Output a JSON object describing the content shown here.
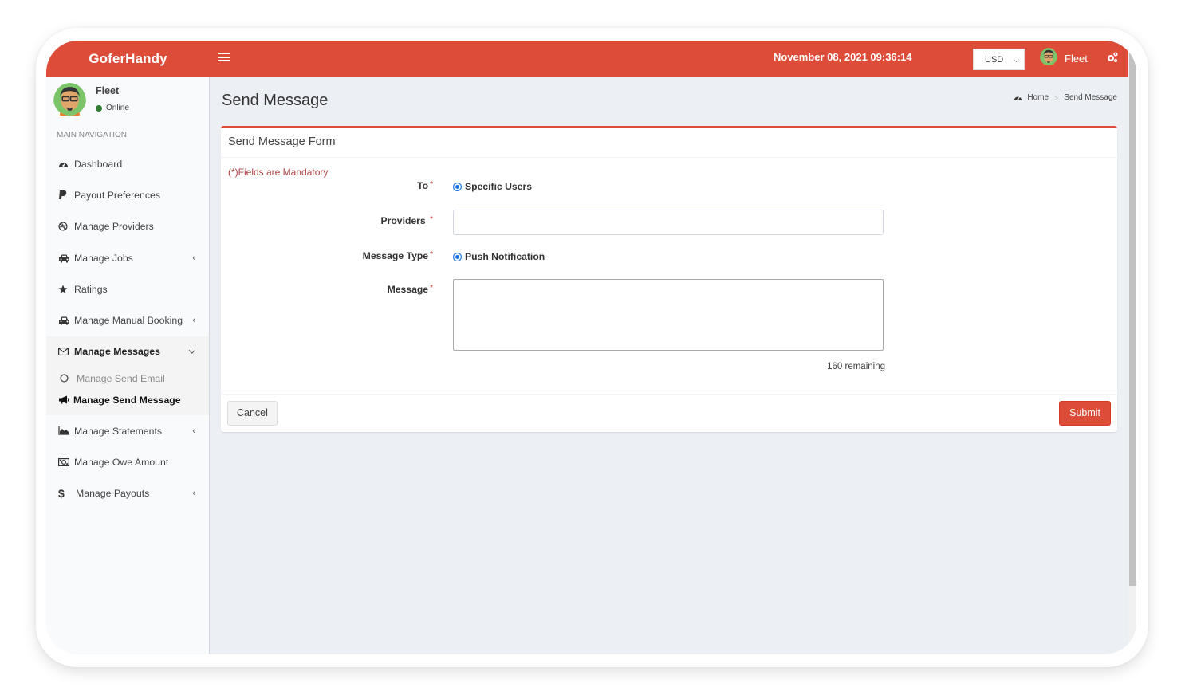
{
  "app": {
    "brand": "GoferHandy",
    "brand_color": "#dd4b39"
  },
  "header": {
    "menu_toggle_icon": "hamburger-icon",
    "datetime": "November 08, 2021 09:36:14",
    "currency": {
      "selected": "USD"
    },
    "user": {
      "name": "Fleet",
      "avatar_icon": "avatar"
    },
    "settings_icon": "gears-icon"
  },
  "sidebar": {
    "user": {
      "name": "Fleet",
      "status": "Online",
      "status_color": "#2e7d32"
    },
    "nav_header": "MAIN NAVIGATION",
    "items": [
      {
        "label": "Dashboard",
        "icon": "dashboard-icon"
      },
      {
        "label": "Payout Preferences",
        "icon": "paypal-icon"
      },
      {
        "label": "Manage Providers",
        "icon": "dribbble-icon"
      },
      {
        "label": "Manage Jobs",
        "icon": "taxi-icon",
        "has_children": true
      },
      {
        "label": "Ratings",
        "icon": "star-icon"
      },
      {
        "label": "Manage Manual Booking",
        "icon": "taxi-icon",
        "has_children": true
      },
      {
        "label": "Manage Messages",
        "icon": "envelope-icon",
        "has_children": true,
        "expanded": true,
        "children": [
          {
            "label": "Manage Send Email",
            "icon": "circle-icon",
            "active": false
          },
          {
            "label": "Manage Send Message",
            "icon": "bullhorn-icon",
            "active": true
          }
        ]
      },
      {
        "label": "Manage Statements",
        "icon": "area-chart-icon",
        "has_children": true
      },
      {
        "label": "Manage Owe Amount",
        "icon": "money-icon"
      },
      {
        "label": "Manage Payouts",
        "icon": "dollar-icon",
        "has_children": true
      }
    ]
  },
  "page": {
    "title": "Send Message",
    "breadcrumb": [
      {
        "label": "Home",
        "icon": "dashboard-icon"
      },
      {
        "label": "Send Message"
      }
    ]
  },
  "form": {
    "title": "Send Message Form",
    "mandatory_note": "(*)Fields are Mandatory",
    "fields": {
      "to": {
        "label": "To",
        "required": "*",
        "option": "Specific Users",
        "checked": true
      },
      "providers": {
        "label": "Providers",
        "required": "*",
        "value": "",
        "placeholder": ""
      },
      "message_type": {
        "label": "Message Type",
        "required": "*",
        "option": "Push Notification",
        "checked": true
      },
      "message": {
        "label": "Message",
        "required": "*",
        "value": "",
        "remaining": "160 remaining"
      }
    },
    "buttons": {
      "cancel": "Cancel",
      "submit": "Submit"
    }
  }
}
